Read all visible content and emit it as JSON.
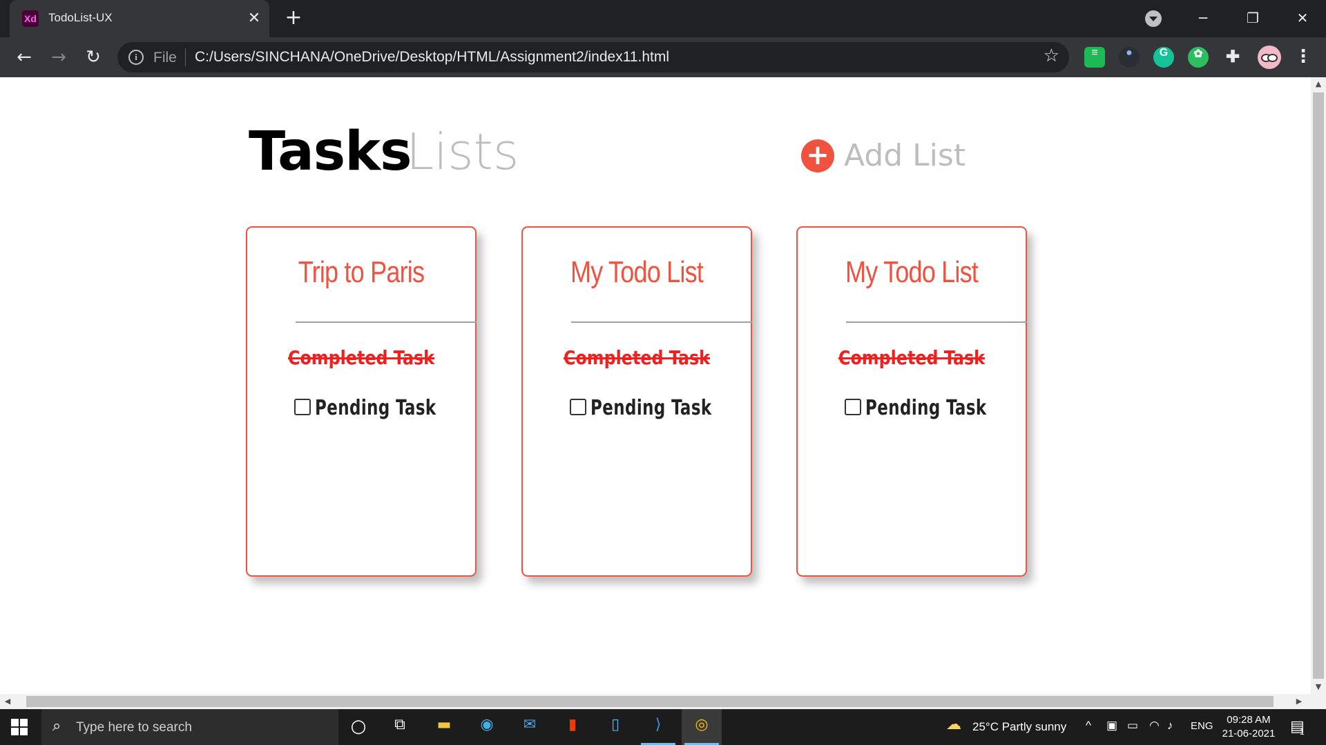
{
  "browser": {
    "tab_title": "TodoList-UX",
    "tab_favicon_text": "Xd",
    "omnibox_scheme": "File",
    "url": "C:/Users/SINCHANA/OneDrive/Desktop/HTML/Assignment2/index11.html",
    "extensions": [
      {
        "name": "extension-green-icon",
        "color": "#1db954"
      },
      {
        "name": "extension-paw-icon",
        "color": "#1a73e8"
      },
      {
        "name": "grammarly-icon",
        "color": "#15c39a",
        "text": "G"
      },
      {
        "name": "evernote-icon",
        "color": "#2dbe60"
      },
      {
        "name": "puzzle-icon",
        "color": "#e8eaed"
      }
    ]
  },
  "page": {
    "title_bold": "Tasks",
    "title_light": "Lists",
    "add_list_label": "Add List",
    "accent_color": "#ef5340",
    "cards": [
      {
        "title": "Trip to Paris",
        "completed_task": "Completed Task",
        "pending_task": "Pending Task"
      },
      {
        "title": "My Todo List",
        "completed_task": "Completed Task",
        "pending_task": "Pending Task"
      },
      {
        "title": "My Todo List",
        "completed_task": "Completed Task",
        "pending_task": "Pending Task"
      }
    ]
  },
  "taskbar": {
    "search_placeholder": "Type here to search",
    "weather": "25°C  Partly sunny",
    "language": "ENG",
    "time": "09:28 AM",
    "date": "21-06-2021",
    "notification_count": "1"
  }
}
